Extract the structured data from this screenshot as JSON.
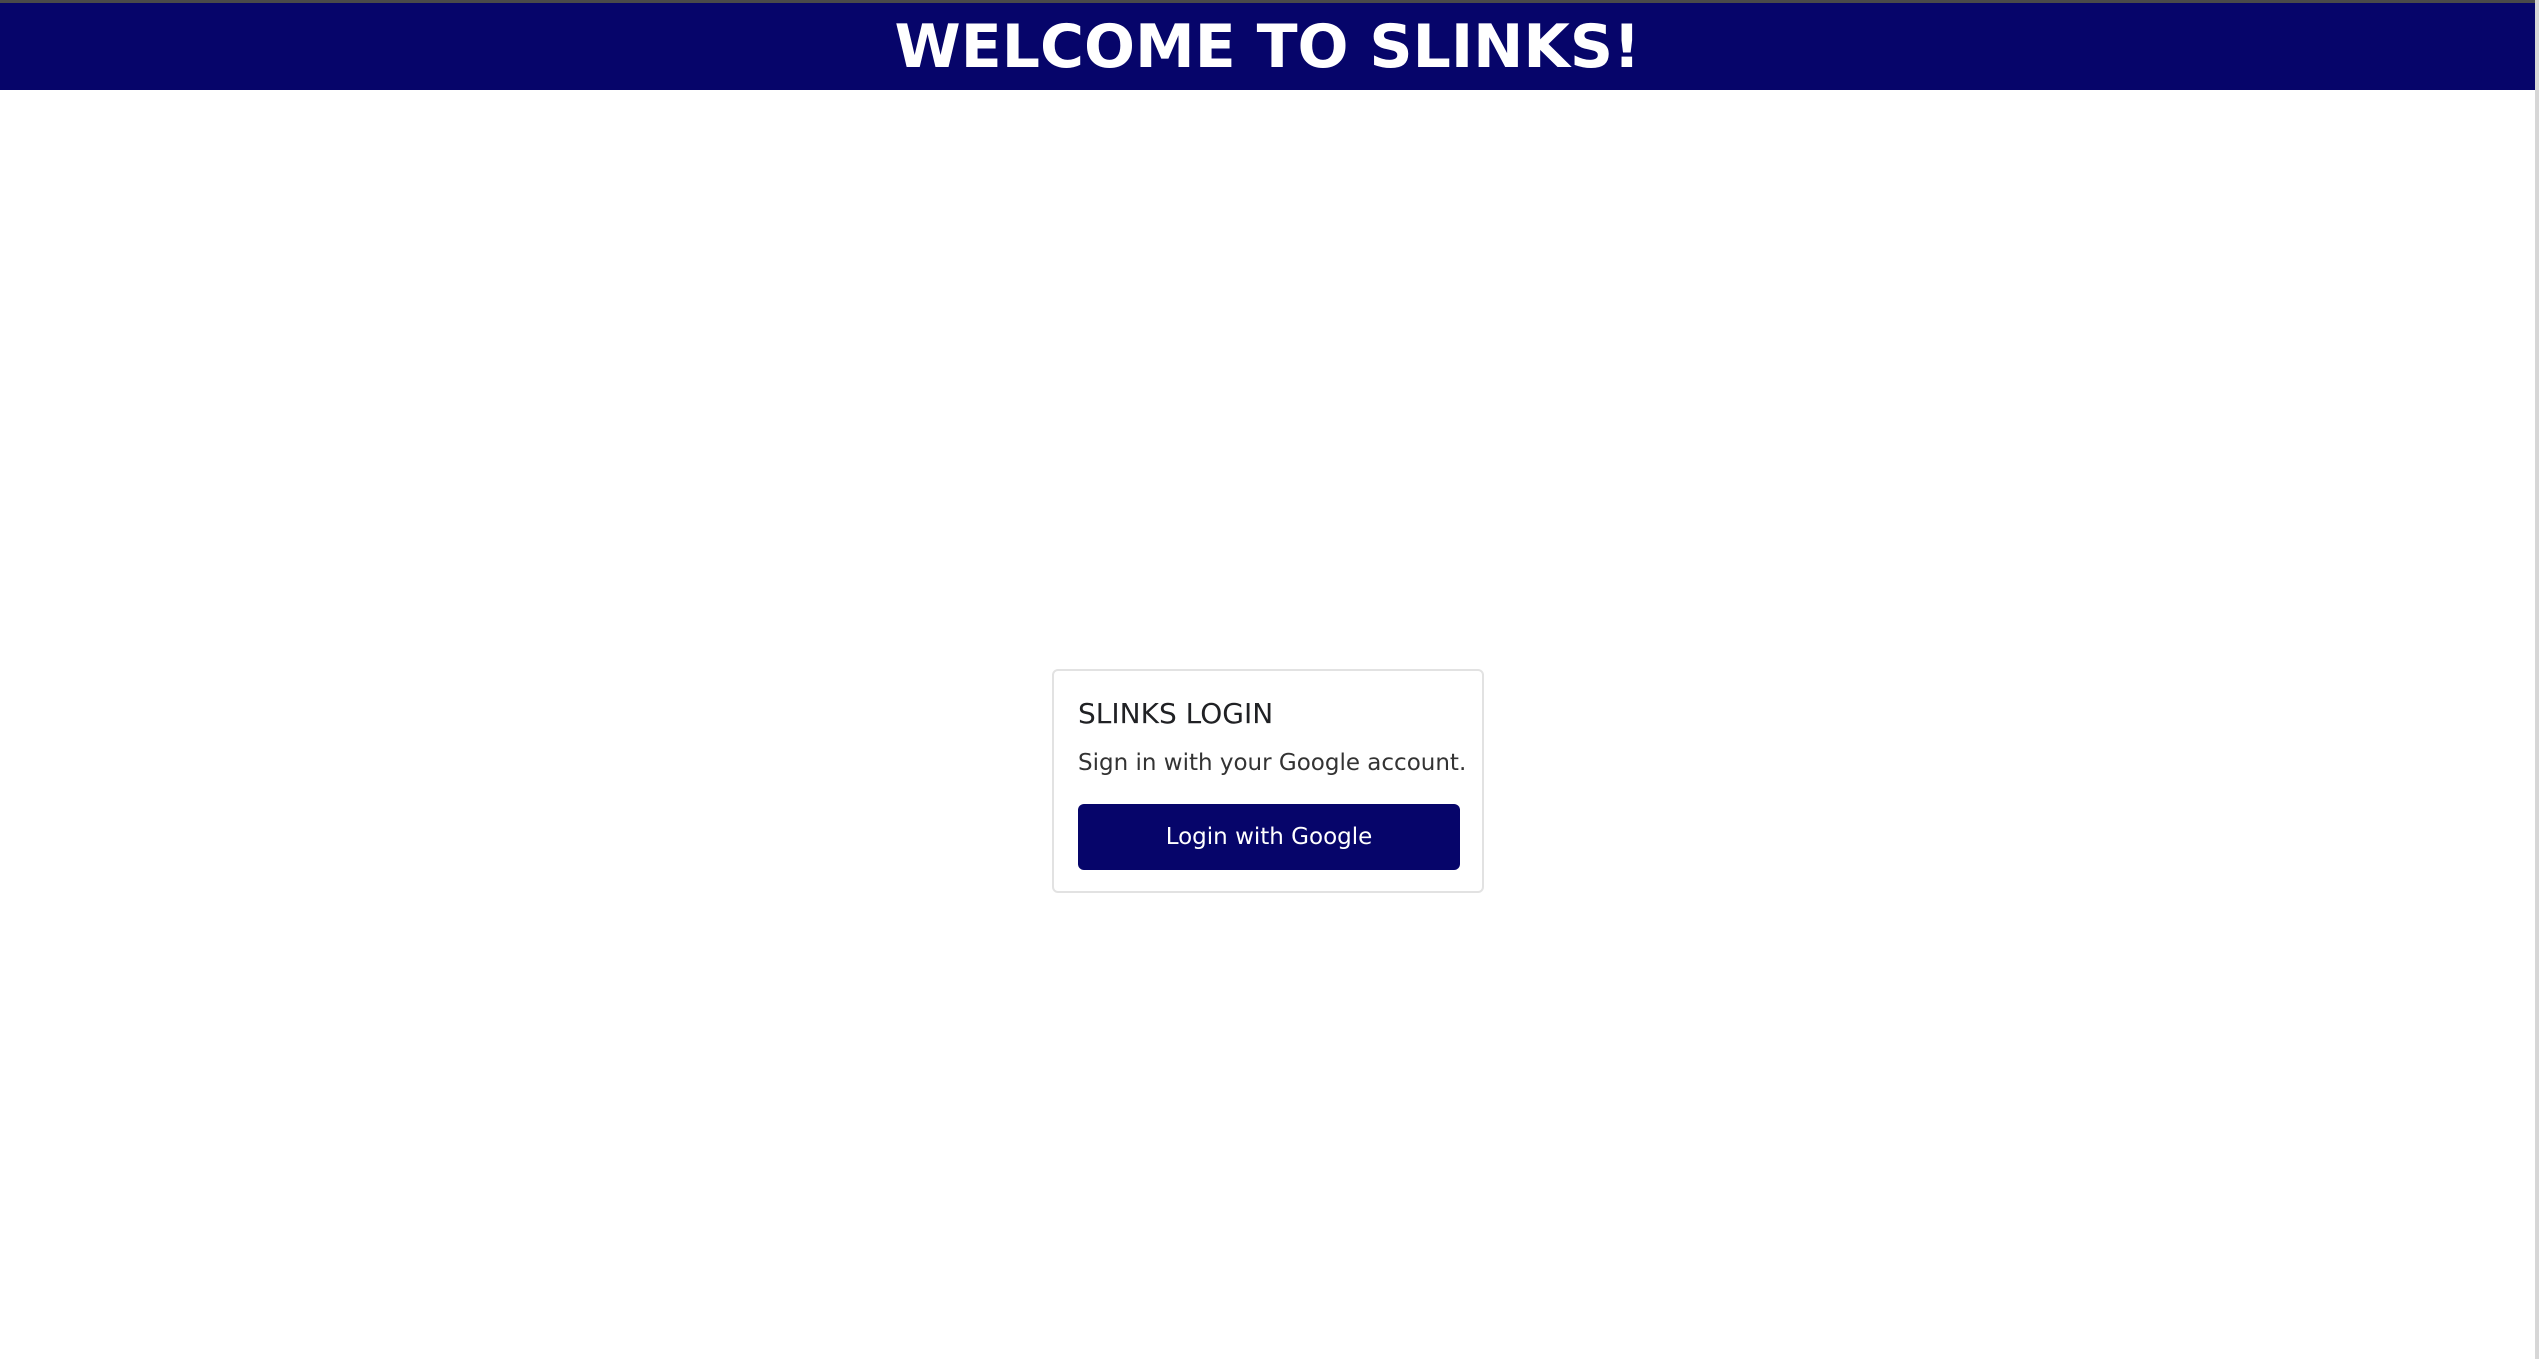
{
  "header": {
    "title": "WELCOME TO SLINKS!"
  },
  "login_card": {
    "title": "SLINKS LOGIN",
    "description": "Sign in with your Google account.",
    "button_label": "Login with Google"
  },
  "colors": {
    "brand": "#06056a",
    "background": "#ffffff",
    "card_border": "#e2e2e2",
    "text": "#202124"
  }
}
